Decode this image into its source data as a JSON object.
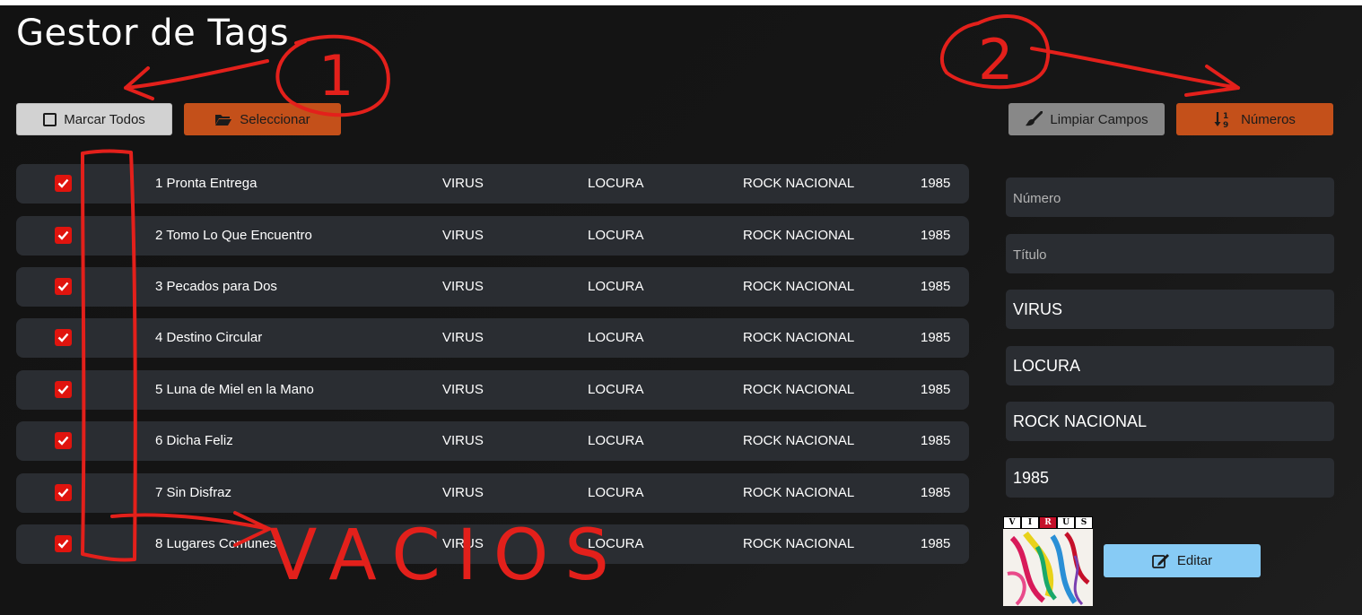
{
  "app": {
    "title": "Gestor de Tags"
  },
  "toolbar": {
    "mark_all_label": "Marcar Todos",
    "select_label": "Seleccionar",
    "clear_label": "Limpiar Campos",
    "numbers_label": "Números"
  },
  "tracks": [
    {
      "title": "1 Pronta Entrega",
      "artist": "VIRUS",
      "album": "LOCURA",
      "genre": "ROCK NACIONAL",
      "year": "1985",
      "checked": true
    },
    {
      "title": "2 Tomo Lo Que Encuentro",
      "artist": "VIRUS",
      "album": "LOCURA",
      "genre": "ROCK NACIONAL",
      "year": "1985",
      "checked": true
    },
    {
      "title": "3 Pecados para Dos",
      "artist": "VIRUS",
      "album": "LOCURA",
      "genre": "ROCK NACIONAL",
      "year": "1985",
      "checked": true
    },
    {
      "title": "4 Destino Circular",
      "artist": "VIRUS",
      "album": "LOCURA",
      "genre": "ROCK NACIONAL",
      "year": "1985",
      "checked": true
    },
    {
      "title": "5 Luna de Miel en la Mano",
      "artist": "VIRUS",
      "album": "LOCURA",
      "genre": "ROCK NACIONAL",
      "year": "1985",
      "checked": true
    },
    {
      "title": "6 Dicha Feliz",
      "artist": "VIRUS",
      "album": "LOCURA",
      "genre": "ROCK NACIONAL",
      "year": "1985",
      "checked": true
    },
    {
      "title": "7 Sin Disfraz",
      "artist": "VIRUS",
      "album": "LOCURA",
      "genre": "ROCK NACIONAL",
      "year": "1985",
      "checked": true
    },
    {
      "title": "8 Lugares Comunes",
      "artist": "VIRUS",
      "album": "LOCURA",
      "genre": "ROCK NACIONAL",
      "year": "1985",
      "checked": true
    }
  ],
  "form": {
    "numero_placeholder": "Número",
    "titulo_placeholder": "Título",
    "artist_value": "VIRUS",
    "album_value": "LOCURA",
    "genre_value": "ROCK NACIONAL",
    "year_value": "1985"
  },
  "cover": {
    "letters": [
      "V",
      "I",
      "R",
      "U",
      "S"
    ]
  },
  "edit": {
    "label": "Editar"
  },
  "annotations": {
    "one": "1",
    "two": "2",
    "note": "VACIOS"
  },
  "colors": {
    "background": "#141414",
    "row": "#2a2d32",
    "accent_orange": "#c4501a",
    "checkbox_red": "#e0140e",
    "edit_blue": "#87cbf5",
    "annotation_red": "#e3201b"
  }
}
